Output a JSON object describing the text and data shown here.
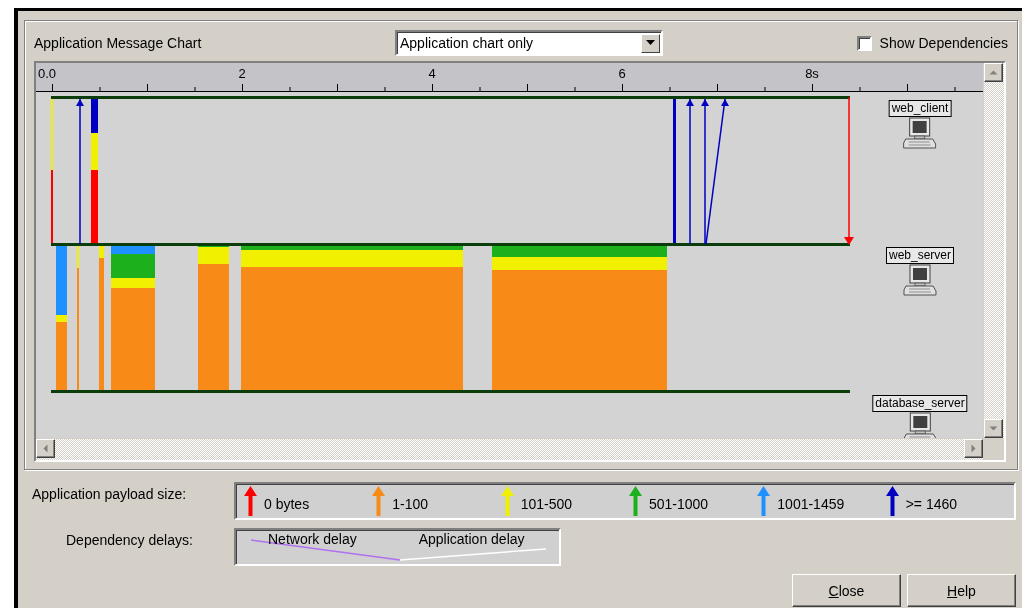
{
  "panel": {
    "title": "Application Message Chart"
  },
  "view_select": {
    "value": "Application chart only"
  },
  "show_dependencies": {
    "label": "Show Dependencies",
    "checked": false
  },
  "ruler": {
    "ticks": [
      "0.0",
      "2",
      "4",
      "6",
      "8s"
    ]
  },
  "nodes": [
    {
      "label": "web_client"
    },
    {
      "label": "web_server"
    },
    {
      "label": "database_server"
    }
  ],
  "payload_legend": {
    "label": "Application payload size:",
    "items": [
      {
        "label": "0 bytes",
        "color": "#ff0000"
      },
      {
        "label": "1-100",
        "color": "#f88a18"
      },
      {
        "label": "101-500",
        "color": "#f0f000"
      },
      {
        "label": "501-1000",
        "color": "#1cb01c"
      },
      {
        "label": "1001-1459",
        "color": "#1e90ff"
      },
      {
        "label": ">= 1460",
        "color": "#0000c0"
      }
    ]
  },
  "delay_legend": {
    "label": "Dependency delays:",
    "items": [
      {
        "label": "Network delay",
        "color": "#b070f0"
      },
      {
        "label": "Application delay",
        "color": "#ffffff"
      }
    ]
  },
  "buttons": [
    {
      "label": "Close"
    },
    {
      "label": "Help"
    }
  ]
}
